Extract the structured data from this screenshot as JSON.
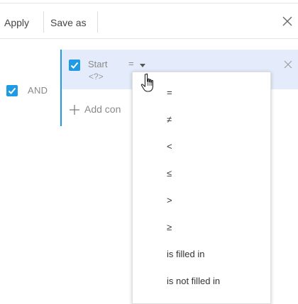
{
  "toolbar": {
    "apply_label": "Apply",
    "save_as_label": "Save as",
    "close_icon": "close-icon"
  },
  "group": {
    "operator_label": "AND",
    "checked": true
  },
  "condition": {
    "checked": true,
    "column": "Start",
    "operator": "=",
    "value": "<?>",
    "delete_icon": "close-icon"
  },
  "add_condition_label": "Add con",
  "operator_menu": {
    "items": [
      "=",
      "≠",
      "<",
      "≤",
      ">",
      "≥",
      "is filled in",
      "is not filled in"
    ]
  },
  "colors": {
    "accent": "#1f9be6",
    "selected_row": "#e4ecfb"
  }
}
